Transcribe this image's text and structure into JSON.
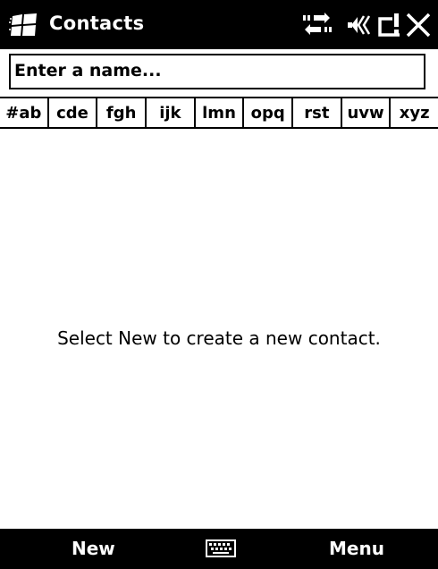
{
  "titlebar": {
    "title": "Contacts",
    "icons": [
      "windows-start-icon",
      "connectivity-icon",
      "volume-icon",
      "signal-icon",
      "close-icon"
    ]
  },
  "search": {
    "placeholder": "Enter a name..."
  },
  "alphabet_tabs": [
    "#ab",
    "cde",
    "fgh",
    "ijk",
    "lmn",
    "opq",
    "rst",
    "uvw",
    "xyz"
  ],
  "content": {
    "empty_message": "Select New to create a new contact."
  },
  "menubar": {
    "left_softkey": "New",
    "right_softkey": "Menu",
    "center_icon": "keyboard-icon"
  },
  "colors": {
    "bars_background": "#000000",
    "bars_text": "#ffffff",
    "content_background": "#ffffff",
    "text": "#000000"
  }
}
